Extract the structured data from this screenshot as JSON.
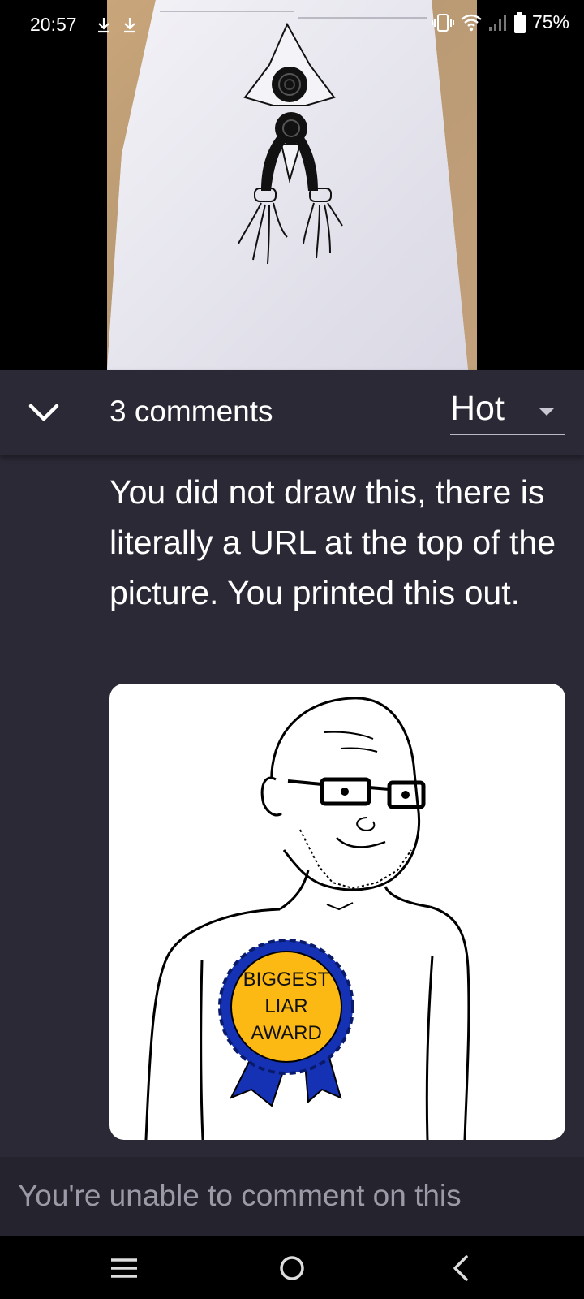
{
  "status_bar": {
    "time": "20:57",
    "battery_percent": "75%",
    "icons": [
      "download-icon",
      "download-icon",
      "vibrate-icon",
      "wifi-icon",
      "cell-signal-icon",
      "battery-icon"
    ]
  },
  "comments_header": {
    "count_label": "3 comments",
    "sort_value": "Hot",
    "collapse_icon": "chevron-down-icon"
  },
  "comment": {
    "text": "You did not draw this, there is literally a URL at the top of the picture. You printed this out.",
    "image": {
      "ribbon_line1": "BIGGEST",
      "ribbon_line2": "LIAR",
      "ribbon_line3": "AWARD"
    }
  },
  "comment_bar": {
    "disabled_text": "You're unable to comment on this"
  },
  "nav_bar": {
    "icons": [
      "recent-apps-icon",
      "home-icon",
      "back-icon"
    ]
  },
  "colors": {
    "panel_bg": "#2a2935",
    "bar_bg": "#24232e",
    "ribbon_gold": "#fdb913",
    "ribbon_blue": "#1532b5"
  }
}
